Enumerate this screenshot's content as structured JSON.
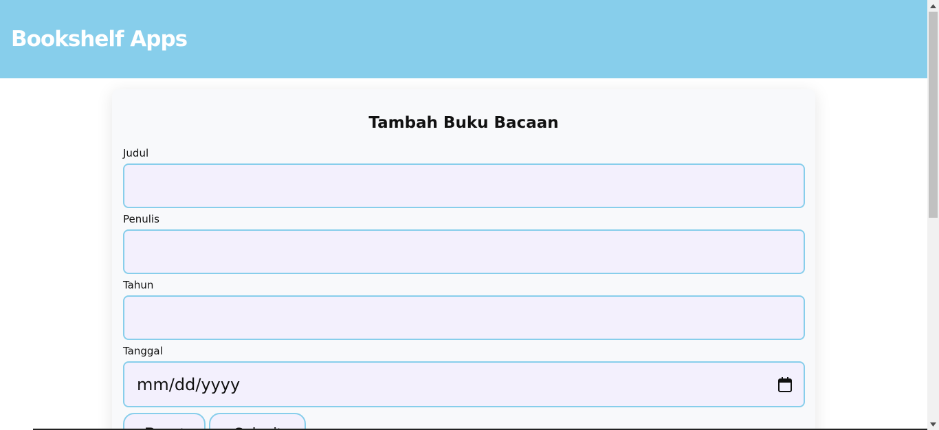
{
  "header": {
    "title": "Bookshelf Apps"
  },
  "form": {
    "title": "Tambah Buku Bacaan",
    "fields": [
      {
        "label": "Judul",
        "value": ""
      },
      {
        "label": "Penulis",
        "value": ""
      },
      {
        "label": "Tahun",
        "value": ""
      },
      {
        "label": "Tanggal",
        "placeholder": "mm/dd/yyyy"
      }
    ],
    "buttons": {
      "reset": "Reset",
      "submit": "Submit"
    }
  },
  "icons": {
    "date_picker": "calendar-icon",
    "scroll_up": "scroll-up-arrow",
    "scroll_down": "scroll-down-arrow"
  },
  "colors": {
    "header_bg": "#87ceeb",
    "input_bg": "#f3f0fd",
    "input_border": "#87ceeb",
    "card_bg": "#f8f9fb"
  }
}
